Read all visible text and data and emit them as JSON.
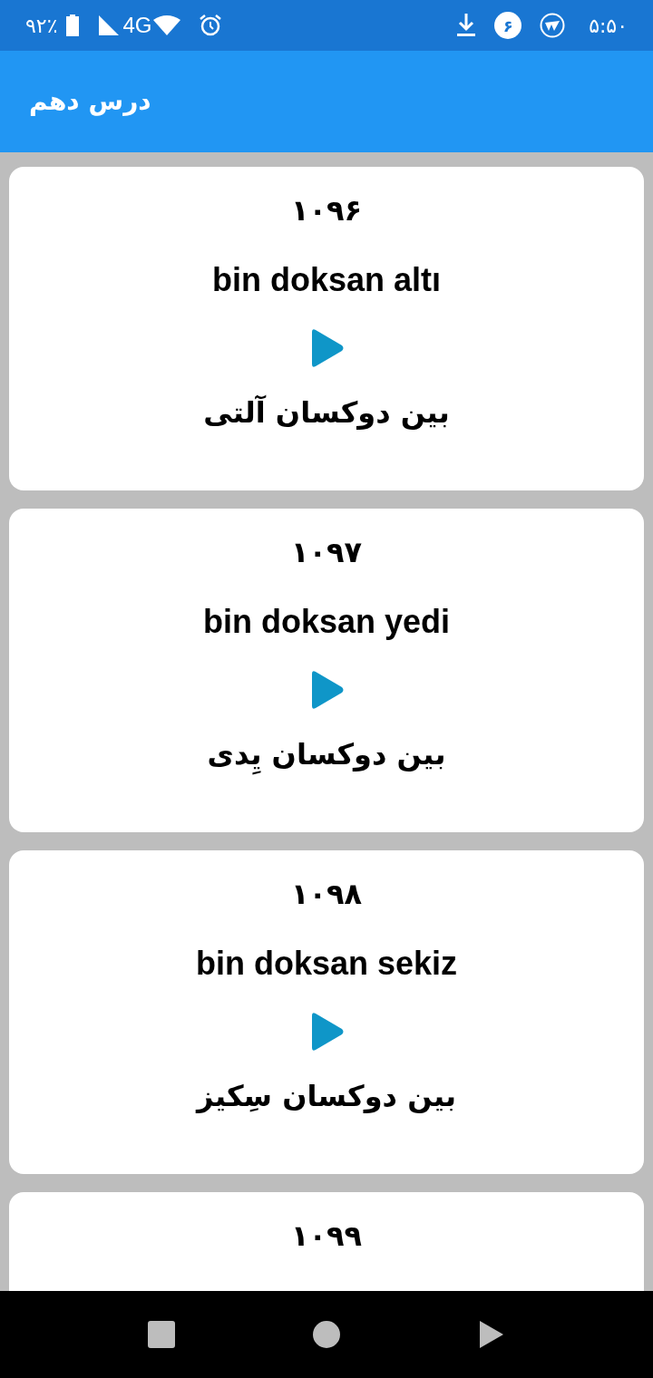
{
  "status_bar": {
    "battery": "۹۲٪",
    "network": "4G",
    "badge": "۶",
    "time": "۵:۵۰"
  },
  "app_bar": {
    "title": "درس دهم"
  },
  "cards": [
    {
      "number": "۱۰۹۶",
      "turkish": "bin doksan altı",
      "persian": "بین دوکسان آلتی"
    },
    {
      "number": "۱۰۹۷",
      "turkish": "bin doksan yedi",
      "persian": "بین دوکسان یِدی"
    },
    {
      "number": "۱۰۹۸",
      "turkish": "bin doksan sekiz",
      "persian": "بین دوکسان سِکیز"
    },
    {
      "number": "۱۰۹۹"
    }
  ]
}
